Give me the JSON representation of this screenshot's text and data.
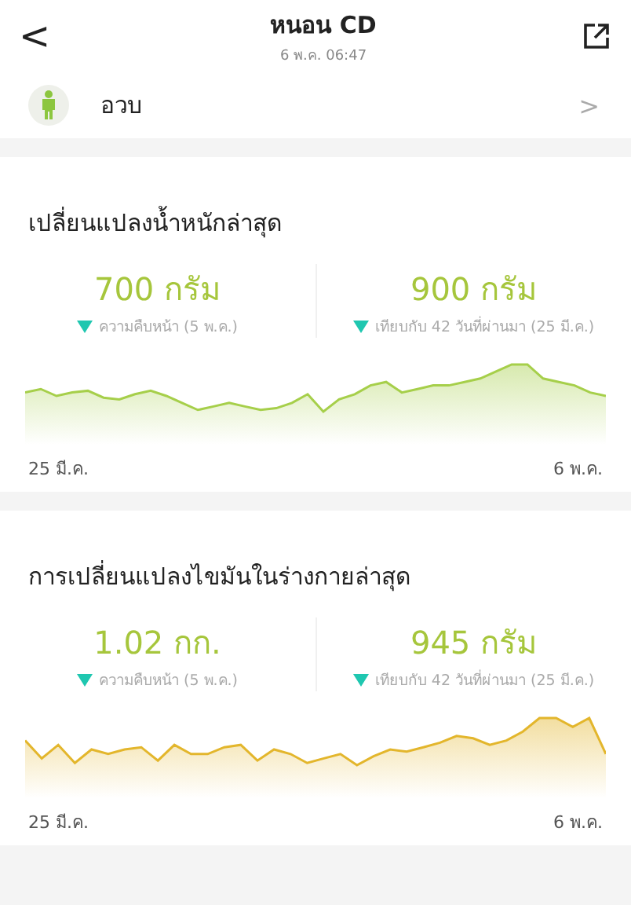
{
  "header": {
    "back": "<",
    "title": "หนอน CD",
    "subtitle": "6 พ.ค. 06:47"
  },
  "profile": {
    "label": "อวบ",
    "chevron": ">"
  },
  "cards": [
    {
      "title": "เปลี่ยนแปลงน้ำหนักล่าสุด",
      "color": "#a6cf4a",
      "stats": [
        {
          "value": "700",
          "unit": "กรัม",
          "note": "ความคืบหน้า (5 พ.ค.)"
        },
        {
          "value": "900",
          "unit": "กรัม",
          "note": "เทียบกับ 42 วันที่ผ่านมา (25 มี.ค.)"
        }
      ],
      "axis": [
        "25 มี.ค.",
        "6 พ.ค."
      ]
    },
    {
      "title": "การเปลี่ยนแปลงไขมันในร่างกายล่าสุด",
      "color": "#e3b62c",
      "stats": [
        {
          "value": "1.02",
          "unit": "กก.",
          "note": "ความคืบหน้า (5 พ.ค.)"
        },
        {
          "value": "945",
          "unit": "กรัม",
          "note": "เทียบกับ 42 วันที่ผ่านมา (25 มี.ค.)"
        }
      ],
      "axis": [
        "25 มี.ค.",
        "6 พ.ค."
      ]
    }
  ]
}
